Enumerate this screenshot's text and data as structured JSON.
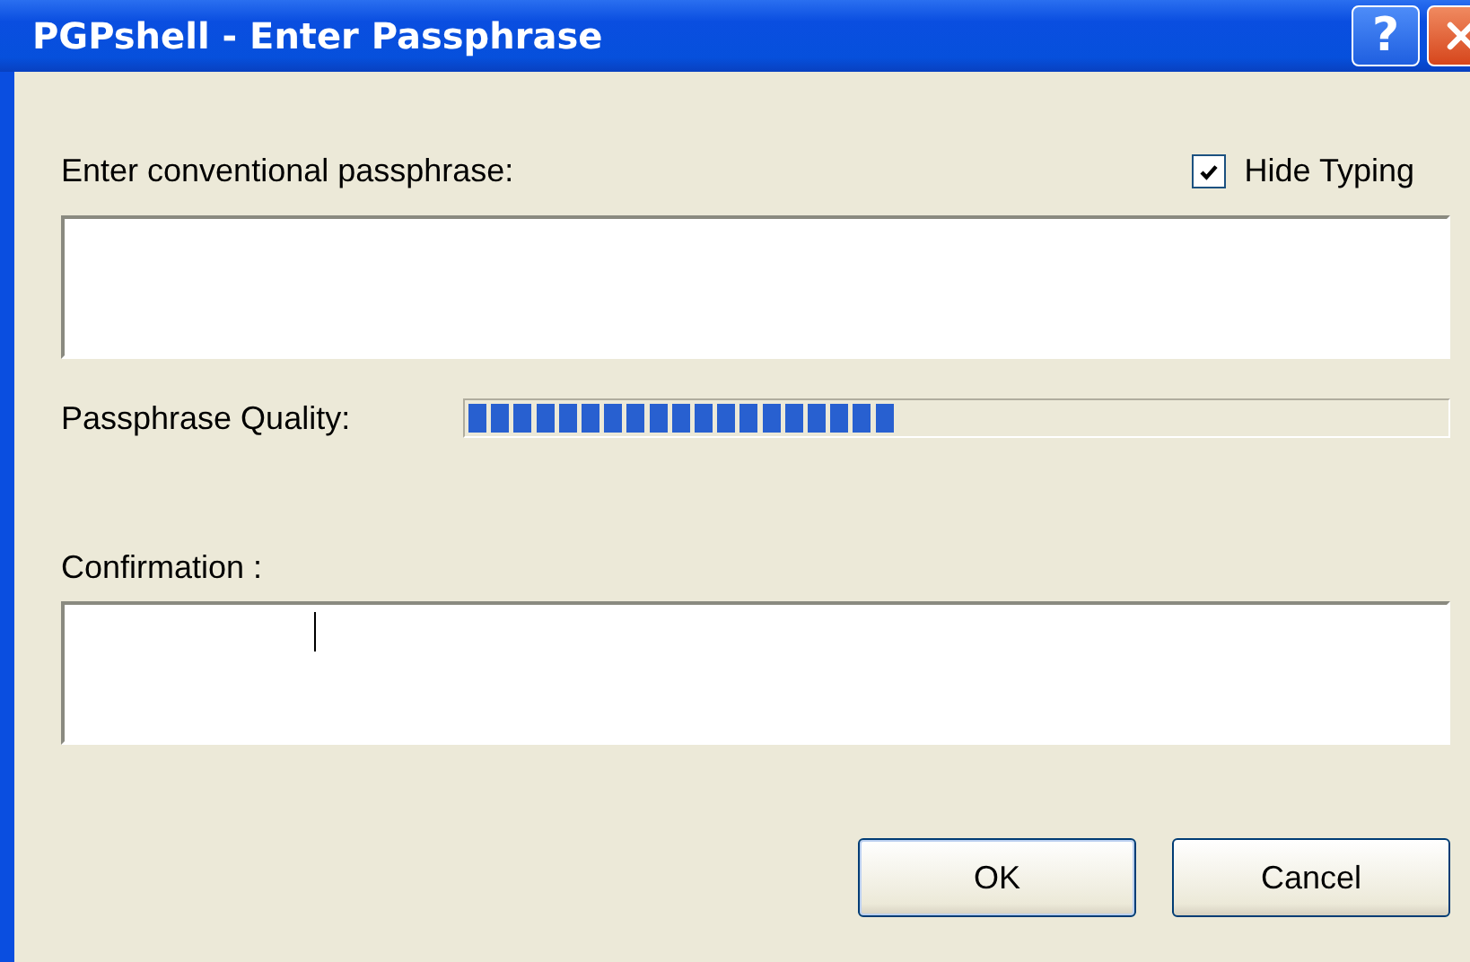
{
  "window": {
    "title": "PGPshell - Enter Passphrase",
    "help_button": "?"
  },
  "passphrase": {
    "label": "Enter conventional passphrase:"
  },
  "hide_typing": {
    "label": "Hide Typing",
    "checked": true
  },
  "quality": {
    "label": "Passphrase Quality:",
    "level": 0.435
  },
  "confirmation": {
    "label": "Confirmation :"
  },
  "buttons": [
    {
      "label": "OK",
      "default": true
    },
    {
      "label": "Cancel",
      "default": false
    }
  ]
}
